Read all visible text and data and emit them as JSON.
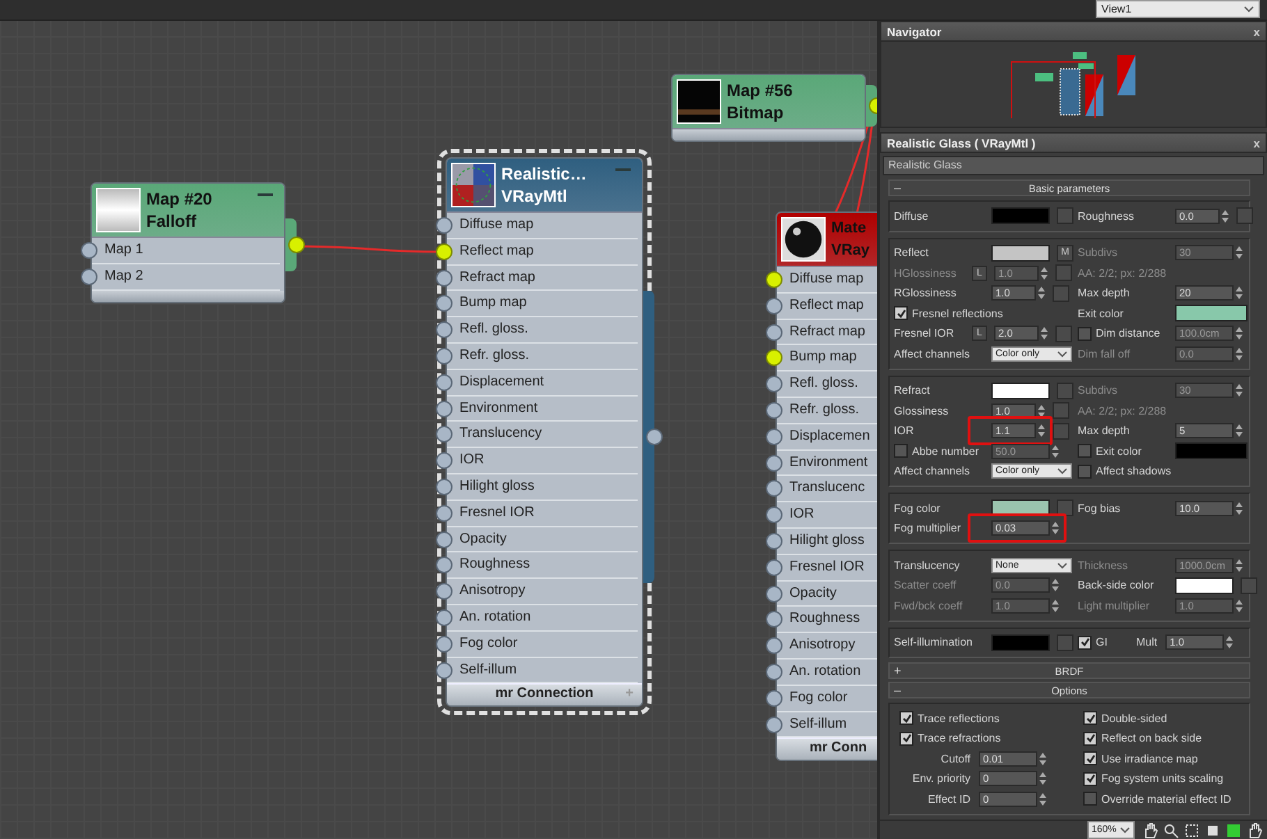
{
  "view_selector": {
    "value": "View1"
  },
  "canvas": {
    "nodes": [
      {
        "kind": "map",
        "title": "Map #20",
        "subtitle": "Falloff",
        "color": "#5aa878",
        "selected": false,
        "collapsible": true,
        "output_connected": true,
        "slots": [
          {
            "label": "Map 1",
            "connected": false
          },
          {
            "label": "Map 2",
            "connected": false
          }
        ]
      },
      {
        "kind": "material",
        "title": "Realistic…",
        "subtitle": "VRayMtl",
        "color": "#2f5f80",
        "selected": true,
        "collapsible": true,
        "output_connected": false,
        "footer": "mr Connection",
        "footer_sign": "+",
        "slots": [
          {
            "label": "Diffuse map",
            "connected": false
          },
          {
            "label": "Reflect map",
            "connected": true
          },
          {
            "label": "Refract map",
            "connected": false
          },
          {
            "label": "Bump map",
            "connected": false
          },
          {
            "label": "Refl. gloss.",
            "connected": false
          },
          {
            "label": "Refr. gloss.",
            "connected": false
          },
          {
            "label": "Displacement",
            "connected": false
          },
          {
            "label": "Environment",
            "connected": false
          },
          {
            "label": "Translucency",
            "connected": false
          },
          {
            "label": "IOR",
            "connected": false
          },
          {
            "label": "Hilight gloss",
            "connected": false
          },
          {
            "label": "Fresnel IOR",
            "connected": false
          },
          {
            "label": "Opacity",
            "connected": false
          },
          {
            "label": "Roughness",
            "connected": false
          },
          {
            "label": "Anisotropy",
            "connected": false
          },
          {
            "label": "An. rotation",
            "connected": false
          },
          {
            "label": "Fog color",
            "connected": false
          },
          {
            "label": "Self-illum",
            "connected": false
          }
        ]
      },
      {
        "kind": "map",
        "title": "Map #56",
        "subtitle": "Bitmap",
        "color": "#5aa878",
        "selected": false,
        "collapsible": false,
        "output_connected": true
      },
      {
        "kind": "material",
        "title": "Mate",
        "subtitle": "VRay",
        "color": "#b00000",
        "selected": false,
        "collapsible": false,
        "footer": "mr Conn",
        "slots": [
          {
            "label": "Diffuse map",
            "connected": true
          },
          {
            "label": "Reflect map",
            "connected": false
          },
          {
            "label": "Refract map",
            "connected": false
          },
          {
            "label": "Bump map",
            "connected": true
          },
          {
            "label": "Refl. gloss.",
            "connected": false
          },
          {
            "label": "Refr. gloss.",
            "connected": false
          },
          {
            "label": "Displacemen",
            "connected": false
          },
          {
            "label": "Environment",
            "connected": false
          },
          {
            "label": "Translucenc",
            "connected": false
          },
          {
            "label": "IOR",
            "connected": false
          },
          {
            "label": "Hilight gloss",
            "connected": false
          },
          {
            "label": "Fresnel IOR",
            "connected": false
          },
          {
            "label": "Opacity",
            "connected": false
          },
          {
            "label": "Roughness",
            "connected": false
          },
          {
            "label": "Anisotropy",
            "connected": false
          },
          {
            "label": "An. rotation",
            "connected": false
          },
          {
            "label": "Fog color",
            "connected": false
          },
          {
            "label": "Self-illum",
            "connected": false
          }
        ]
      }
    ]
  },
  "navigator": {
    "title": "Navigator",
    "close": "x"
  },
  "material_panel": {
    "title": "Realistic Glass  ( VRayMtl )",
    "close": "x",
    "name": "Realistic Glass",
    "rollouts": [
      {
        "title": "Basic parameters",
        "sign": "–",
        "kind": "params",
        "sections": [
          {
            "rows": [
              {
                "left": [
                  {
                    "kind": "swatch",
                    "label": "Diffuse",
                    "color": "#000000",
                    "map_slot": true
                  }
                ],
                "right": [
                  {
                    "kind": "spinner",
                    "label": "Roughness",
                    "value": "0.0",
                    "map_slot": true
                  }
                ]
              }
            ]
          },
          {
            "rows": [
              {
                "left": [
                  {
                    "kind": "swatch",
                    "label": "Reflect",
                    "color": "#c4c4c4",
                    "map_slot": true,
                    "map_label": "M"
                  }
                ],
                "right": [
                  {
                    "kind": "spinner",
                    "label": "Subdivs",
                    "value": "30",
                    "disabled": true
                  }
                ]
              },
              {
                "left": [
                  {
                    "kind": "spinner",
                    "label": "HGlossiness",
                    "lock": "L",
                    "value": "1.0",
                    "disabled": true,
                    "map_slot": true
                  }
                ],
                "right": [
                  {
                    "kind": "info",
                    "text": "AA: 2/2; px: 2/288"
                  }
                ]
              },
              {
                "left": [
                  {
                    "kind": "spinner",
                    "label": "RGlossiness",
                    "value": "1.0",
                    "map_slot": true
                  }
                ],
                "right": [
                  {
                    "kind": "spinner",
                    "label": "Max depth",
                    "value": "20"
                  }
                ]
              },
              {
                "left": [
                  {
                    "kind": "checkbox",
                    "label": "Fresnel reflections",
                    "checked": true
                  }
                ],
                "right": [
                  {
                    "kind": "swatch",
                    "label": "Exit color",
                    "color": "#88c8aa"
                  }
                ]
              },
              {
                "left": [
                  {
                    "kind": "spinner",
                    "label": "Fresnel IOR",
                    "lock": "L",
                    "value": "2.0",
                    "map_slot": true
                  }
                ],
                "right": [
                  {
                    "kind": "checkbox",
                    "label": "Dim distance",
                    "checked": false
                  },
                  {
                    "kind": "spinner",
                    "value": "100.0cm",
                    "disabled": true
                  }
                ]
              },
              {
                "left": [
                  {
                    "kind": "dropdown",
                    "label": "Affect channels",
                    "value": "Color only"
                  }
                ],
                "right": [
                  {
                    "kind": "spinner",
                    "label": "Dim fall off",
                    "value": "0.0",
                    "disabled": true
                  }
                ]
              }
            ]
          },
          {
            "rows": [
              {
                "left": [
                  {
                    "kind": "swatch",
                    "label": "Refract",
                    "color": "#ffffff",
                    "map_slot": true
                  }
                ],
                "right": [
                  {
                    "kind": "spinner",
                    "label": "Subdivs",
                    "value": "30",
                    "disabled": true
                  }
                ]
              },
              {
                "left": [
                  {
                    "kind": "spinner",
                    "label": "Glossiness",
                    "value": "1.0",
                    "map_slot": true
                  }
                ],
                "right": [
                  {
                    "kind": "info",
                    "text": "AA: 2/2; px: 2/288"
                  }
                ]
              },
              {
                "left": [
                  {
                    "kind": "spinner",
                    "label": "IOR",
                    "value": "1.1",
                    "map_slot": true,
                    "highlighted": true
                  }
                ],
                "right": [
                  {
                    "kind": "spinner",
                    "label": "Max depth",
                    "value": "5"
                  }
                ]
              },
              {
                "left": [
                  {
                    "kind": "checkbox",
                    "label": "Abbe number",
                    "checked": false
                  },
                  {
                    "kind": "spinner",
                    "value": "50.0",
                    "disabled": true
                  }
                ],
                "right": [
                  {
                    "kind": "checkbox",
                    "label": "Exit color",
                    "checked": false
                  },
                  {
                    "kind": "swatch",
                    "color": "#000000"
                  }
                ]
              },
              {
                "left": [
                  {
                    "kind": "dropdown",
                    "label": "Affect channels",
                    "value": "Color only"
                  }
                ],
                "right": [
                  {
                    "kind": "checkbox",
                    "label": "Affect shadows",
                    "checked": false
                  }
                ]
              }
            ]
          },
          {
            "rows": [
              {
                "left": [
                  {
                    "kind": "swatch",
                    "label": "Fog color",
                    "color": "#9ac4ae",
                    "map_slot": true
                  }
                ],
                "right": [
                  {
                    "kind": "spinner",
                    "label": "Fog bias",
                    "value": "10.0"
                  }
                ]
              },
              {
                "left": [
                  {
                    "kind": "spinner",
                    "label": "Fog multiplier",
                    "value": "0.03",
                    "highlighted": true
                  }
                ]
              }
            ]
          },
          {
            "rows": [
              {
                "left": [
                  {
                    "kind": "dropdown",
                    "label": "Translucency",
                    "value": "None"
                  }
                ],
                "right": [
                  {
                    "kind": "spinner",
                    "label": "Thickness",
                    "value": "1000.0cm",
                    "disabled": true
                  }
                ]
              },
              {
                "left": [
                  {
                    "kind": "spinner",
                    "label": "Scatter coeff",
                    "value": "0.0",
                    "disabled": true
                  }
                ],
                "right": [
                  {
                    "kind": "swatch",
                    "label": "Back-side color",
                    "color": "#ffffff",
                    "map_slot": true
                  }
                ]
              },
              {
                "left": [
                  {
                    "kind": "spinner",
                    "label": "Fwd/bck coeff",
                    "value": "1.0",
                    "disabled": true
                  }
                ],
                "right": [
                  {
                    "kind": "spinner",
                    "label": "Light multiplier",
                    "value": "1.0",
                    "disabled": true
                  }
                ]
              }
            ]
          },
          {
            "rows": [
              {
                "left": [
                  {
                    "kind": "swatch",
                    "label": "Self-illumination",
                    "color": "#000000",
                    "map_slot": true
                  }
                ],
                "right": [
                  {
                    "kind": "checkbox",
                    "label": "GI",
                    "checked": true
                  },
                  {
                    "kind": "spinner",
                    "label": "Mult",
                    "value": "1.0"
                  }
                ]
              }
            ]
          }
        ]
      },
      {
        "title": "BRDF",
        "sign": "+"
      },
      {
        "title": "Options",
        "sign": "–",
        "kind": "options",
        "sections": [
          {
            "rows": [
              {
                "left": [
                  {
                    "kind": "checkbox",
                    "label": "Trace reflections",
                    "checked": true
                  }
                ],
                "right": [
                  {
                    "kind": "checkbox",
                    "label": "Double-sided",
                    "checked": true
                  }
                ]
              },
              {
                "left": [
                  {
                    "kind": "checkbox",
                    "label": "Trace refractions",
                    "checked": true
                  }
                ],
                "right": [
                  {
                    "kind": "checkbox",
                    "label": "Reflect on back side",
                    "checked": true
                  }
                ]
              },
              {
                "left": [
                  {
                    "kind": "spinner",
                    "label": "Cutoff",
                    "value": "0.01"
                  }
                ],
                "right": [
                  {
                    "kind": "checkbox",
                    "label": "Use irradiance map",
                    "checked": true
                  }
                ]
              },
              {
                "left": [
                  {
                    "kind": "spinner",
                    "label": "Env. priority",
                    "value": "0"
                  }
                ],
                "right": [
                  {
                    "kind": "checkbox",
                    "label": "Fog system units scaling",
                    "checked": true
                  }
                ]
              },
              {
                "left": [
                  {
                    "kind": "spinner",
                    "label": "Effect ID",
                    "value": "0"
                  }
                ],
                "right": [
                  {
                    "kind": "checkbox",
                    "label": "Override material effect ID",
                    "checked": false
                  }
                ]
              }
            ]
          }
        ]
      }
    ]
  },
  "toolbar": {
    "zoom": "160%"
  }
}
